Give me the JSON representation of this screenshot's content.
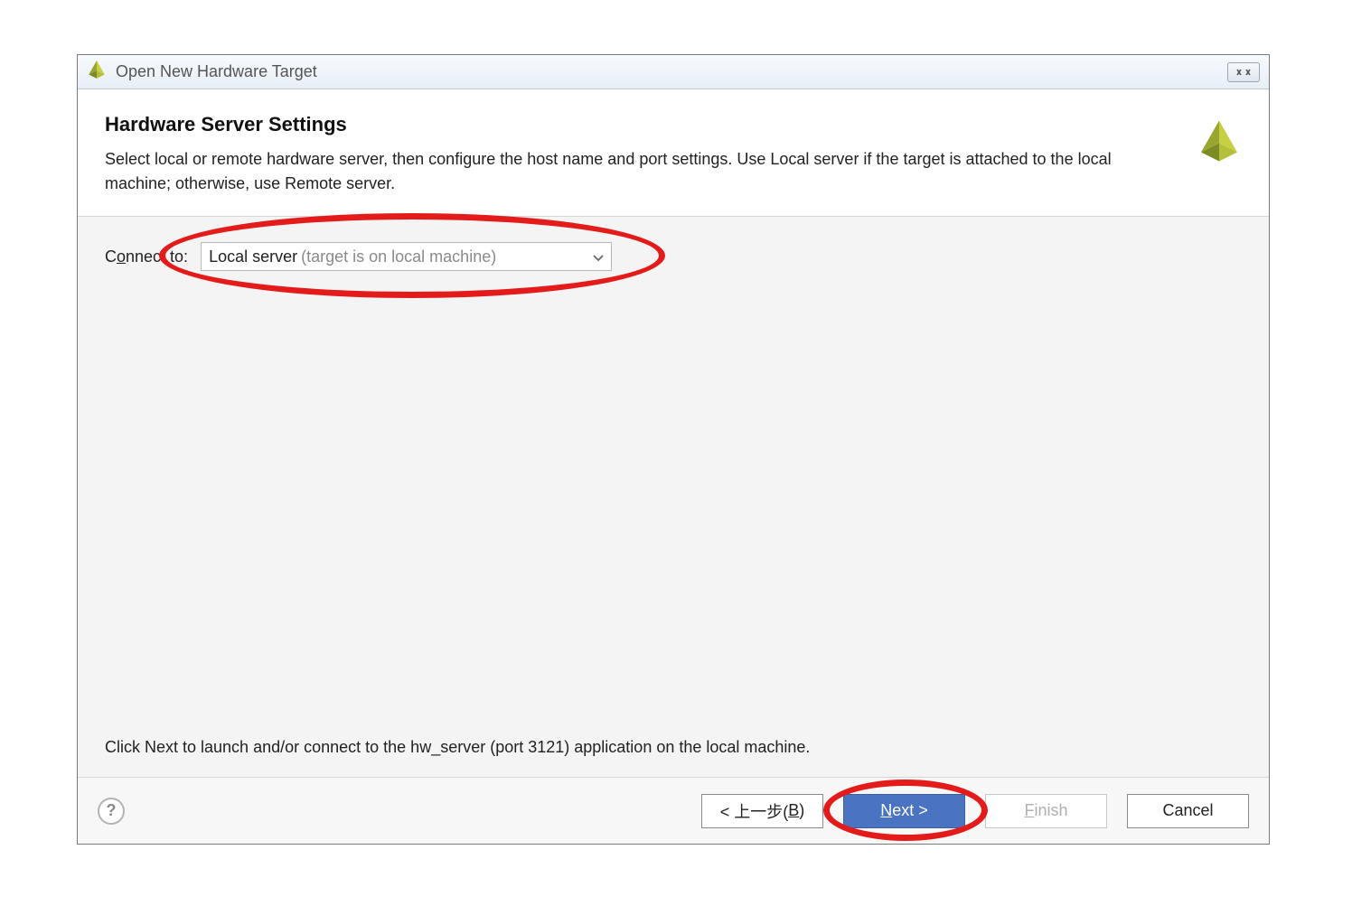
{
  "window": {
    "title": "Open New Hardware Target"
  },
  "header": {
    "title": "Hardware Server Settings",
    "description": "Select local or remote hardware server, then configure the host name and port settings. Use Local server if the target is attached to the local machine; otherwise, use Remote server."
  },
  "form": {
    "connect_label_pre": "C",
    "connect_label_ak": "o",
    "connect_label_post": "nnect to:",
    "connect_value": "Local server",
    "connect_hint": "(target is on local machine)"
  },
  "content_hint": "Click Next to launch and/or connect to the hw_server (port 3121) application on the local machine.",
  "footer": {
    "help": "?",
    "back_pre": "< 上一步(",
    "back_ak": "B",
    "back_post": ")",
    "next_ak": "N",
    "next_post": "ext >",
    "finish_ak": "F",
    "finish_post": "inish",
    "cancel": "Cancel"
  }
}
